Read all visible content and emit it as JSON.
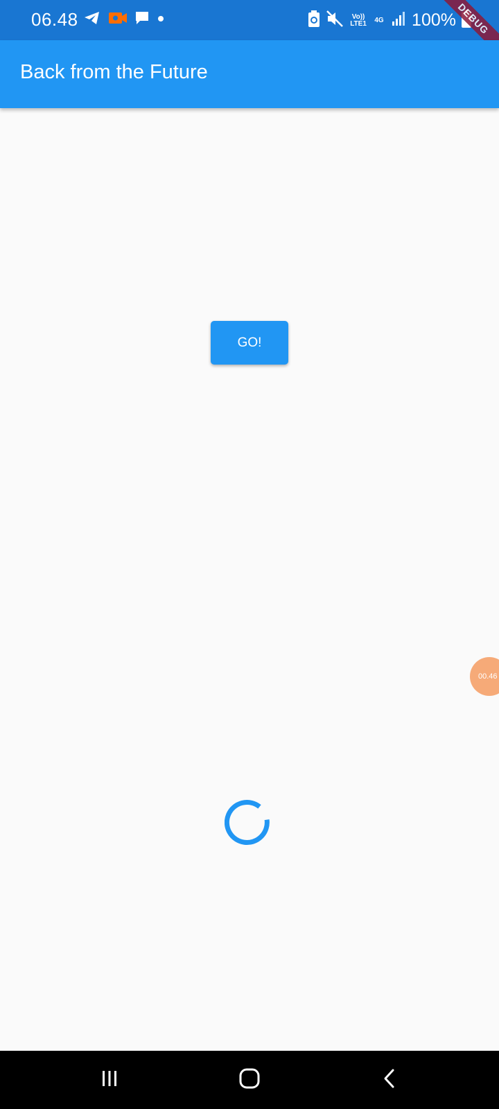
{
  "status_bar": {
    "time": "06.48",
    "icons_left": [
      "telegram-icon",
      "video-recorder-icon",
      "message-icon",
      "dot-icon"
    ],
    "icons_right": [
      "battery-saver-icon",
      "mute-icon",
      "volte-icon",
      "4g-icon",
      "signal-icon",
      "battery-icon"
    ],
    "volte_label": "Vo)) LTE1",
    "network_label": "4G",
    "battery_percent": "100%",
    "recorder_color": "#ff6d00"
  },
  "debug_banner": {
    "label": "DEBUG"
  },
  "app_bar": {
    "title": "Back from the Future",
    "color": "#2196f3"
  },
  "main": {
    "go_button_label": "GO!",
    "spinner_color": "#2196f3"
  },
  "floating_bubble": {
    "label": "00.46",
    "color": "#f6aa78"
  },
  "nav_bar": {
    "buttons": [
      "recent-apps-icon",
      "home-icon",
      "back-icon"
    ]
  }
}
